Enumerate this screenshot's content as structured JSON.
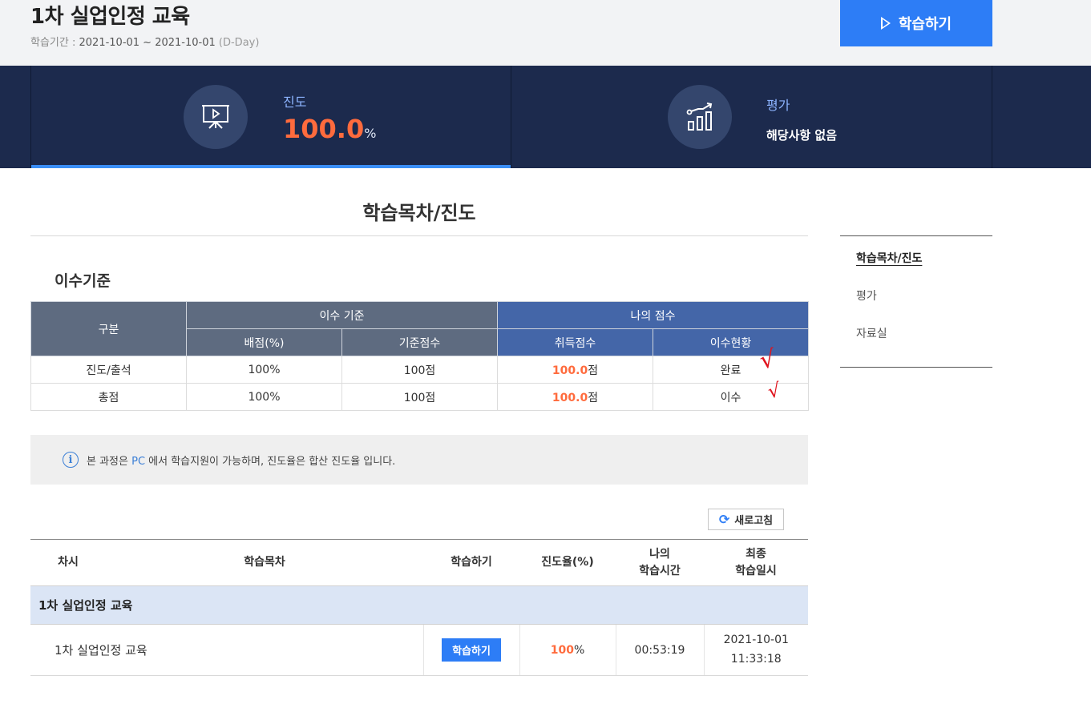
{
  "course": {
    "title": "1차 실업인정 교육",
    "period_label": "학습기간 : ",
    "period_dates": "2021-10-01 ~ 2021-10-01",
    "dday": "(D-Day)",
    "study_button": "학습하기"
  },
  "stats": {
    "progress_label": "진도",
    "progress_value": "100.0",
    "progress_unit": "%",
    "progress_fraction": 1.0,
    "eval_label": "평가",
    "eval_value": "해당사항 없음"
  },
  "section_title": "학습목차/진도",
  "side_nav": {
    "items": [
      "학습목차/진도",
      "평가",
      "자료실"
    ]
  },
  "criteria": {
    "title": "이수기준",
    "headers": {
      "category": "구분",
      "criteria_group": "이수 기준",
      "my_score_group": "나의 점수",
      "weight": "배점(%)",
      "base_score": "기준점수",
      "earned": "취득점수",
      "status": "이수현황"
    },
    "rows": [
      {
        "category": "진도/출석",
        "weight": "100%",
        "base": "100점",
        "earned": "100.0",
        "earned_unit": "점",
        "status": "완료"
      },
      {
        "category": "총점",
        "weight": "100%",
        "base": "100점",
        "earned": "100.0",
        "earned_unit": "점",
        "status": "이수"
      }
    ],
    "check_mark": "√"
  },
  "notice": {
    "icon": "i",
    "prefix": "본 과정은 ",
    "highlight": "PC",
    "suffix": " 에서 학습지원이 가능하며, 진도율은 합산 진도율 입니다."
  },
  "refresh_label": "새로고침",
  "lessons": {
    "headers": {
      "num": "차시",
      "title": "학습목차",
      "study": "학습하기",
      "progress": "진도율(%)",
      "time_line1": "나의",
      "time_line2": "학습시간",
      "last_line1": "최종",
      "last_line2": "학습일시"
    },
    "group_title": "1차 실업인정 교육",
    "rows": [
      {
        "title": "1차 실업인정 교육",
        "button": "학습하기",
        "progress": "100",
        "progress_unit": "%",
        "time": "00:53:19",
        "date": "2021-10-01",
        "clock": "11:33:18"
      }
    ]
  },
  "colors": {
    "accent": "#2d7df6",
    "band": "#1c2a4d",
    "highlight": "#ff6b3d"
  }
}
